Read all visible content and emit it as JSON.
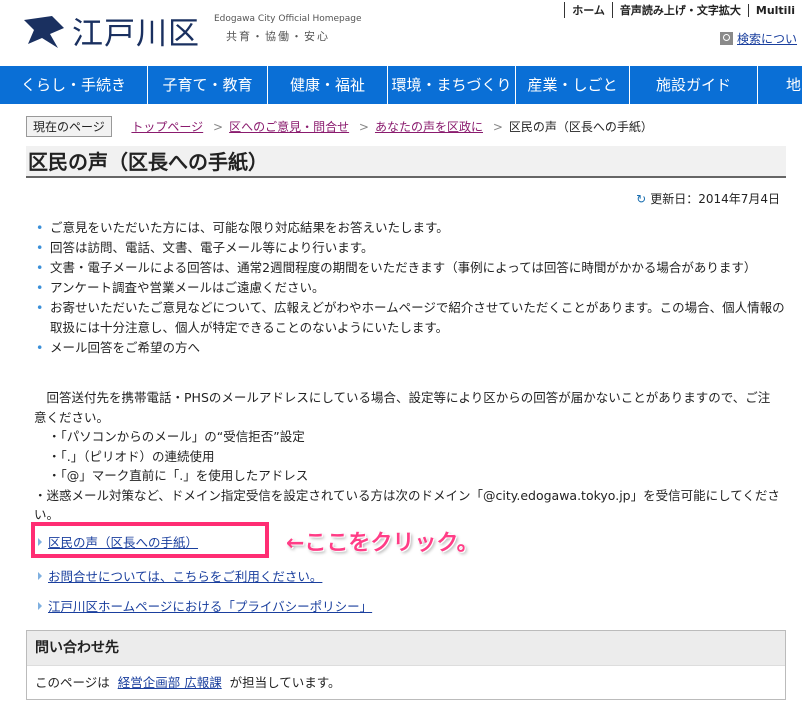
{
  "header": {
    "logo_name": "江戸川区",
    "logo_en": "Edogawa City Official Homepage",
    "logo_sub": "共育・協働・安心",
    "toplinks": [
      "ホーム",
      "音声読み上げ・文字拡大",
      "Multili"
    ],
    "search_label": "検索につい"
  },
  "nav": {
    "items": [
      "くらし・手続き",
      "子育て・教育",
      "健康・福祉",
      "環境・まちづくり",
      "産業・しごと",
      "施設ガイド",
      "地"
    ]
  },
  "breadcrumb": {
    "current_label": "現在のページ",
    "links": [
      "トップページ",
      "区へのご意見・問合せ",
      "あなたの声を区政に"
    ],
    "current": "区民の声（区長への手紙）"
  },
  "page": {
    "title": "区民の声（区長への手紙）",
    "updated": "更新日：2014年7月4日"
  },
  "bullets": [
    "ご意見をいただいた方には、可能な限り対応結果をお答えいたします。",
    "回答は訪問、電話、文書、電子メール等により行います。",
    "文書・電子メールによる回答は、通常2週間程度の期間をいただきます（事例によっては回答に時間がかかる場合があります）",
    "アンケート調査や営業メールはご遠慮ください。",
    "お寄せいただいたご意見などについて、広報えどがわやホームページで紹介させていただくことがあります。この場合、個人情報の取扱には十分注意し、個人が特定できることのないようにいたします。",
    "メール回答をご希望の方へ"
  ],
  "paragraph": {
    "intro": "　回答送付先を携帯電話・PHSのメールアドレスにしている場合、設定等により区からの回答が届かないことがありますので、ご注意ください。",
    "items": [
      "・「パソコンからのメール」の“受信拒否”設定",
      "・「.」（ピリオド）の連続使用",
      "・「@」マーク直前に「.」を使用したアドレス",
      "・迷惑メール対策など、ドメイン指定受信を設定されている方は次のドメイン「@city.edogawa.tokyo.jp」を受信可能にしてください。"
    ]
  },
  "links": {
    "letter": "区民の声（区長への手紙）",
    "inquiry": "お問合せについては、こちらをご利用ください。",
    "privacy": "江戸川区ホームページにおける「プライバシーポリシー」"
  },
  "annotation": "←ここをクリック。",
  "contact": {
    "heading": "問い合わせ先",
    "prefix": "このページは",
    "dept": "経営企画部 広報課",
    "suffix": "が担当しています。"
  },
  "colors": {
    "nav_bg": "#0a6fd6",
    "highlight": "#ff2d73",
    "annotation": "#ff3d86",
    "link": "#1a3f9e",
    "crumb_link": "#8a1b6e"
  }
}
